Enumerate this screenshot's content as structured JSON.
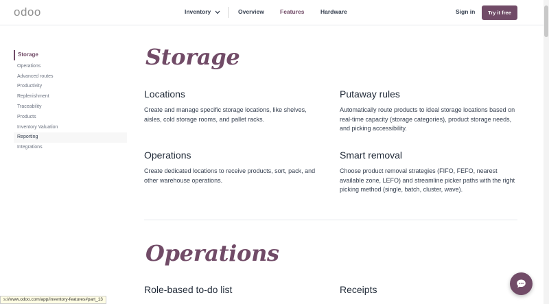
{
  "header": {
    "logo": "odoo",
    "nav": {
      "inventory": "Inventory",
      "overview": "Overview",
      "features": "Features",
      "hardware": "Hardware"
    },
    "sign_in": "Sign in",
    "try_button": "Try it free"
  },
  "sidebar": {
    "items": [
      {
        "label": "Storage"
      },
      {
        "label": "Operations"
      },
      {
        "label": "Advanced routes"
      },
      {
        "label": "Productivity"
      },
      {
        "label": "Replenishment"
      },
      {
        "label": "Traceability"
      },
      {
        "label": "Products"
      },
      {
        "label": "Inventory Valuation"
      },
      {
        "label": "Reporting"
      },
      {
        "label": "Integrations"
      }
    ]
  },
  "sections": {
    "storage": {
      "heading": "Storage",
      "features": [
        {
          "title": "Locations",
          "text": "Create and manage specific storage locations, like shelves, aisles, cold storage rooms, and pallet racks."
        },
        {
          "title": "Putaway rules",
          "text": "Automatically route products to ideal storage locations based on real-time capacity (storage categories), product storage needs, and picking accessibility."
        },
        {
          "title": "Operations",
          "text": "Create dedicated locations to receive products, sort, pack, and other warehouse operations."
        },
        {
          "title": "Smart removal",
          "text": "Choose product removal strategies (FIFO, FEFO, nearest available zone, LEFO) and streamline picker paths with the right picking method (single, batch, cluster, wave)."
        }
      ]
    },
    "operations": {
      "heading": "Operations",
      "features": [
        {
          "title": "Role-based to-do list"
        },
        {
          "title": "Receipts"
        }
      ]
    }
  },
  "status_bar": {
    "url": "s://www.odoo.com/app/inventory-features#part_13"
  },
  "colors": {
    "brand": "#714b67",
    "text": "#374151"
  },
  "icons": {
    "chat": "chat-bubble-icon",
    "chevron": "chevron-down-icon"
  }
}
